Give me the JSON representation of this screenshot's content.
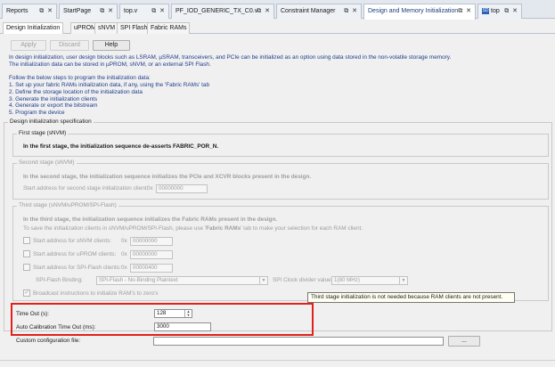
{
  "doc_tabs": [
    {
      "label": "Reports"
    },
    {
      "label": "StartPage"
    },
    {
      "label": "top.v"
    },
    {
      "label": "PF_IOD_GENERIC_TX_C0.v"
    },
    {
      "label": "Constraint Manager"
    },
    {
      "label": "Design and Memory Initialization"
    },
    {
      "label": "top"
    }
  ],
  "tab_controls": "⧉ ✕",
  "sub_tabs": [
    {
      "label": "Design Initialization"
    },
    {
      "label": "uPROM"
    },
    {
      "label": "sNVM"
    },
    {
      "label": "SPI Flash"
    },
    {
      "label": "Fabric RAMs"
    }
  ],
  "toolbar": {
    "apply": "Apply",
    "discard": "Discard",
    "help": "Help"
  },
  "intro": {
    "line1": "In design initialization, user design blocks such as LSRAM, µSRAM, transceivers, and PCIe can be initialized as an option using data stored in the non-volatile storage memory.",
    "line2": "The initialization data can be stored in µPROM, sNVM, or an external SPI Flash.",
    "line3": "Follow the below steps to program the initialization data:",
    "step1": "1. Set up your fabric RAMs initialization data, if any, using the 'Fabric RAMs' tab",
    "step2": "2. Define the storage location of the initialization data",
    "step3": "3. Generate the initialization clients",
    "step4": "4. Generate or export the bitstream",
    "step5": "5. Program the device"
  },
  "spec": {
    "title": "Design initialization specification",
    "first_stage": {
      "title": "First stage (sNVM)",
      "text": "In the first stage, the initialization sequence de-asserts FABRIC_POR_N."
    },
    "second_stage": {
      "title": "Second stage (sNVM)",
      "text": "In the second stage, the initialization sequence initializes the PCIe and XCVR blocks present in the design.",
      "addr_label": "Start address for second stage initialization client:",
      "hex_prefix": "0x",
      "addr_value": "00000000"
    },
    "third_stage": {
      "title": "Third stage (sNVM/uPROM/SPI-Flash)",
      "text": "In the third stage, the initialization sequence initializes the Fabric RAMs present in the design.",
      "info_pre": "To save the initialization clients in sNVM/uPROM/SPI-Flash, please use '",
      "info_bold": "Fabric RAMs",
      "info_post": "' tab to make your selection for each RAM client.",
      "snvm_label": "Start address for sNVM clients:",
      "snvm_value": "00000000",
      "uprom_label": "Start address for uPROM clients:",
      "uprom_value": "00000000",
      "spi_label": "Start address for SPI-Flash clients:",
      "spi_value": "00000400",
      "hex_prefix": "0x",
      "binding_label": "SPI-Flash Binding:",
      "binding_value": "SPI-Flash - No-Binding Plaintext",
      "divider_label": "SPI Clock divider value:",
      "divider_value": "1(80 MHz)",
      "broadcast_label": "Broadcast instructions to initialize RAM's to zero's"
    }
  },
  "tooltip": "Third stage initialization is not needed because RAM clients are not present.",
  "timeout": {
    "label": "Time Out (s):",
    "value": "128"
  },
  "auto_cal": {
    "label": "Auto Calibration Time Out (ms):",
    "value": "3000"
  },
  "custom_config": {
    "label": "Custom configuration file:",
    "value": "",
    "browse": "..."
  },
  "colors": {
    "highlight": "#e2211c",
    "intro_text": "#1f3d8c",
    "tooltip_bg": "#fffff1"
  }
}
